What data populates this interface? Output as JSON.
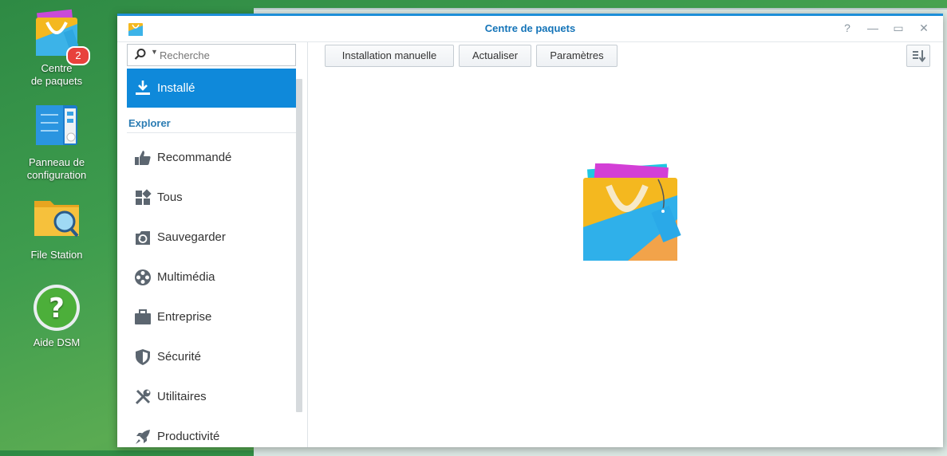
{
  "desktop": {
    "icons": [
      {
        "label_line1": "Centre",
        "label_line2": "de paquets",
        "badge": "2"
      },
      {
        "label_line1": "Panneau de",
        "label_line2": "configuration"
      },
      {
        "label_line1": "File Station",
        "label_line2": ""
      },
      {
        "label_line1": "Aide DSM",
        "label_line2": ""
      }
    ]
  },
  "window": {
    "title": "Centre de paquets",
    "controls": {
      "help": "?",
      "minimize": "—",
      "maximize": "▭",
      "close": "✕"
    }
  },
  "sidebar": {
    "search_placeholder": "Recherche",
    "installed_label": "Installé",
    "section_label": "Explorer",
    "items": [
      {
        "label": "Recommandé",
        "icon": "thumbs-up-icon"
      },
      {
        "label": "Tous",
        "icon": "grid-icon"
      },
      {
        "label": "Sauvegarder",
        "icon": "backup-icon"
      },
      {
        "label": "Multimédia",
        "icon": "film-reel-icon"
      },
      {
        "label": "Entreprise",
        "icon": "briefcase-icon"
      },
      {
        "label": "Sécurité",
        "icon": "shield-icon"
      },
      {
        "label": "Utilitaires",
        "icon": "tools-icon"
      },
      {
        "label": "Productivité",
        "icon": "rocket-icon"
      }
    ]
  },
  "toolbar": {
    "manual_install": "Installation manuelle",
    "refresh": "Actualiser",
    "settings": "Paramètres"
  },
  "colors": {
    "accent": "#0f89da",
    "title": "#1474b8",
    "section": "#2b7cb3",
    "badge": "#e8413c"
  }
}
